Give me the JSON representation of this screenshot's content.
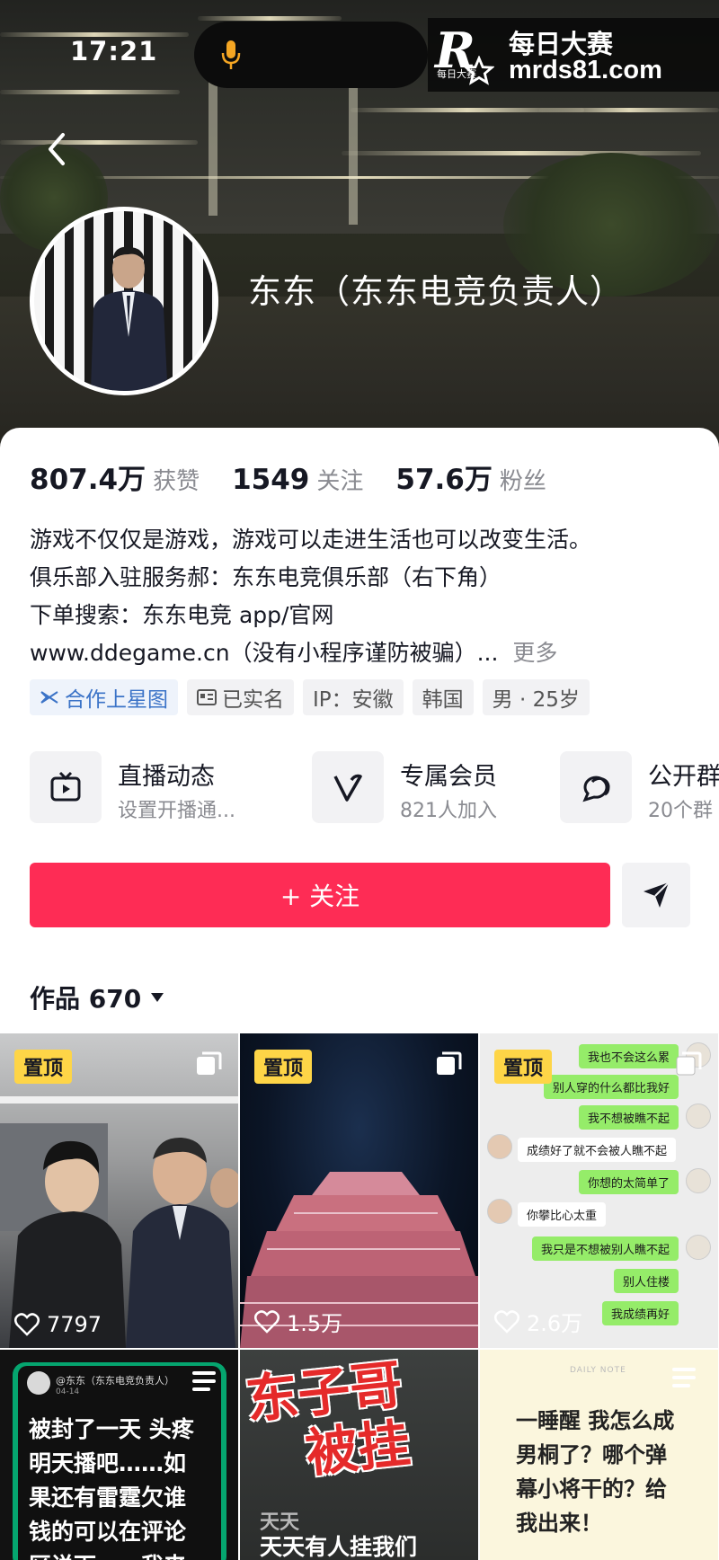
{
  "status_bar": {
    "time": "17:21"
  },
  "watermark": {
    "logo": "R",
    "logo_small": "每日大赛",
    "line1": "每日大赛",
    "line2": "mrds81.com"
  },
  "profile": {
    "nickname": "东东（东东电竞负责人）",
    "stats": [
      {
        "value": "807.4万",
        "label": "获赞"
      },
      {
        "value": "1549",
        "label": "关注"
      },
      {
        "value": "57.6万",
        "label": "粉丝"
      }
    ],
    "bio_lines": [
      "游戏不仅仅是游戏，游戏可以走进生活也可以改变生活。",
      "俱乐部入驻服务郝：东东电竞俱乐部（右下角）",
      "下单搜索：东东电竞 app/官网",
      "www.ddegame.cn（没有小程序谨防被骗）..."
    ],
    "bio_more": "更多",
    "tags": [
      "合作上星图",
      "已实名",
      "IP：安徽",
      "韩国",
      "男 · 25岁"
    ]
  },
  "entries": [
    {
      "title": "直播动态",
      "subtitle": "设置开播通...",
      "icon": "tv-icon"
    },
    {
      "title": "专属会员",
      "subtitle": "821人加入",
      "icon": "v-icon"
    },
    {
      "title": "公开群",
      "subtitle": "20个群",
      "icon": "chat-bubble-icon"
    }
  ],
  "actions": {
    "follow": "+ 关注",
    "share_icon": "send-icon"
  },
  "works": {
    "label": "作品 670"
  },
  "videos": [
    {
      "pinned": "置顶",
      "likes": "7797"
    },
    {
      "pinned": "置顶",
      "likes": "1.5万"
    },
    {
      "pinned": "置顶",
      "likes": "2.6万",
      "chat": [
        "我也不会这么累",
        "别人穿的什么都比我好",
        "我不想被瞧不起",
        "成绩好了就不会被人瞧不起",
        "你想的太简单了",
        "你攀比心太重",
        "我只是不想被别人瞧不起",
        "别人住楼",
        "我成绩再好"
      ]
    },
    {
      "text_head": "@东东（东东电竞负责人）",
      "date": "04-14",
      "text": [
        "被封了一天 头疼",
        "明天播吧……如",
        "果还有雷霆欠谁",
        "钱的可以在评论",
        "区说下……我来"
      ]
    },
    {
      "title": [
        "东子哥",
        "被挂"
      ],
      "caption_small": "天天",
      "caption": "天天有人挂我们"
    },
    {
      "note_head": "DAILY NOTE",
      "text": [
        "一睡醒 我怎么成",
        "男桐了？哪个弹",
        "幕小将干的？给",
        "我出来！"
      ]
    }
  ],
  "colors": {
    "accent": "#fe2c55",
    "pin": "#fed547"
  }
}
